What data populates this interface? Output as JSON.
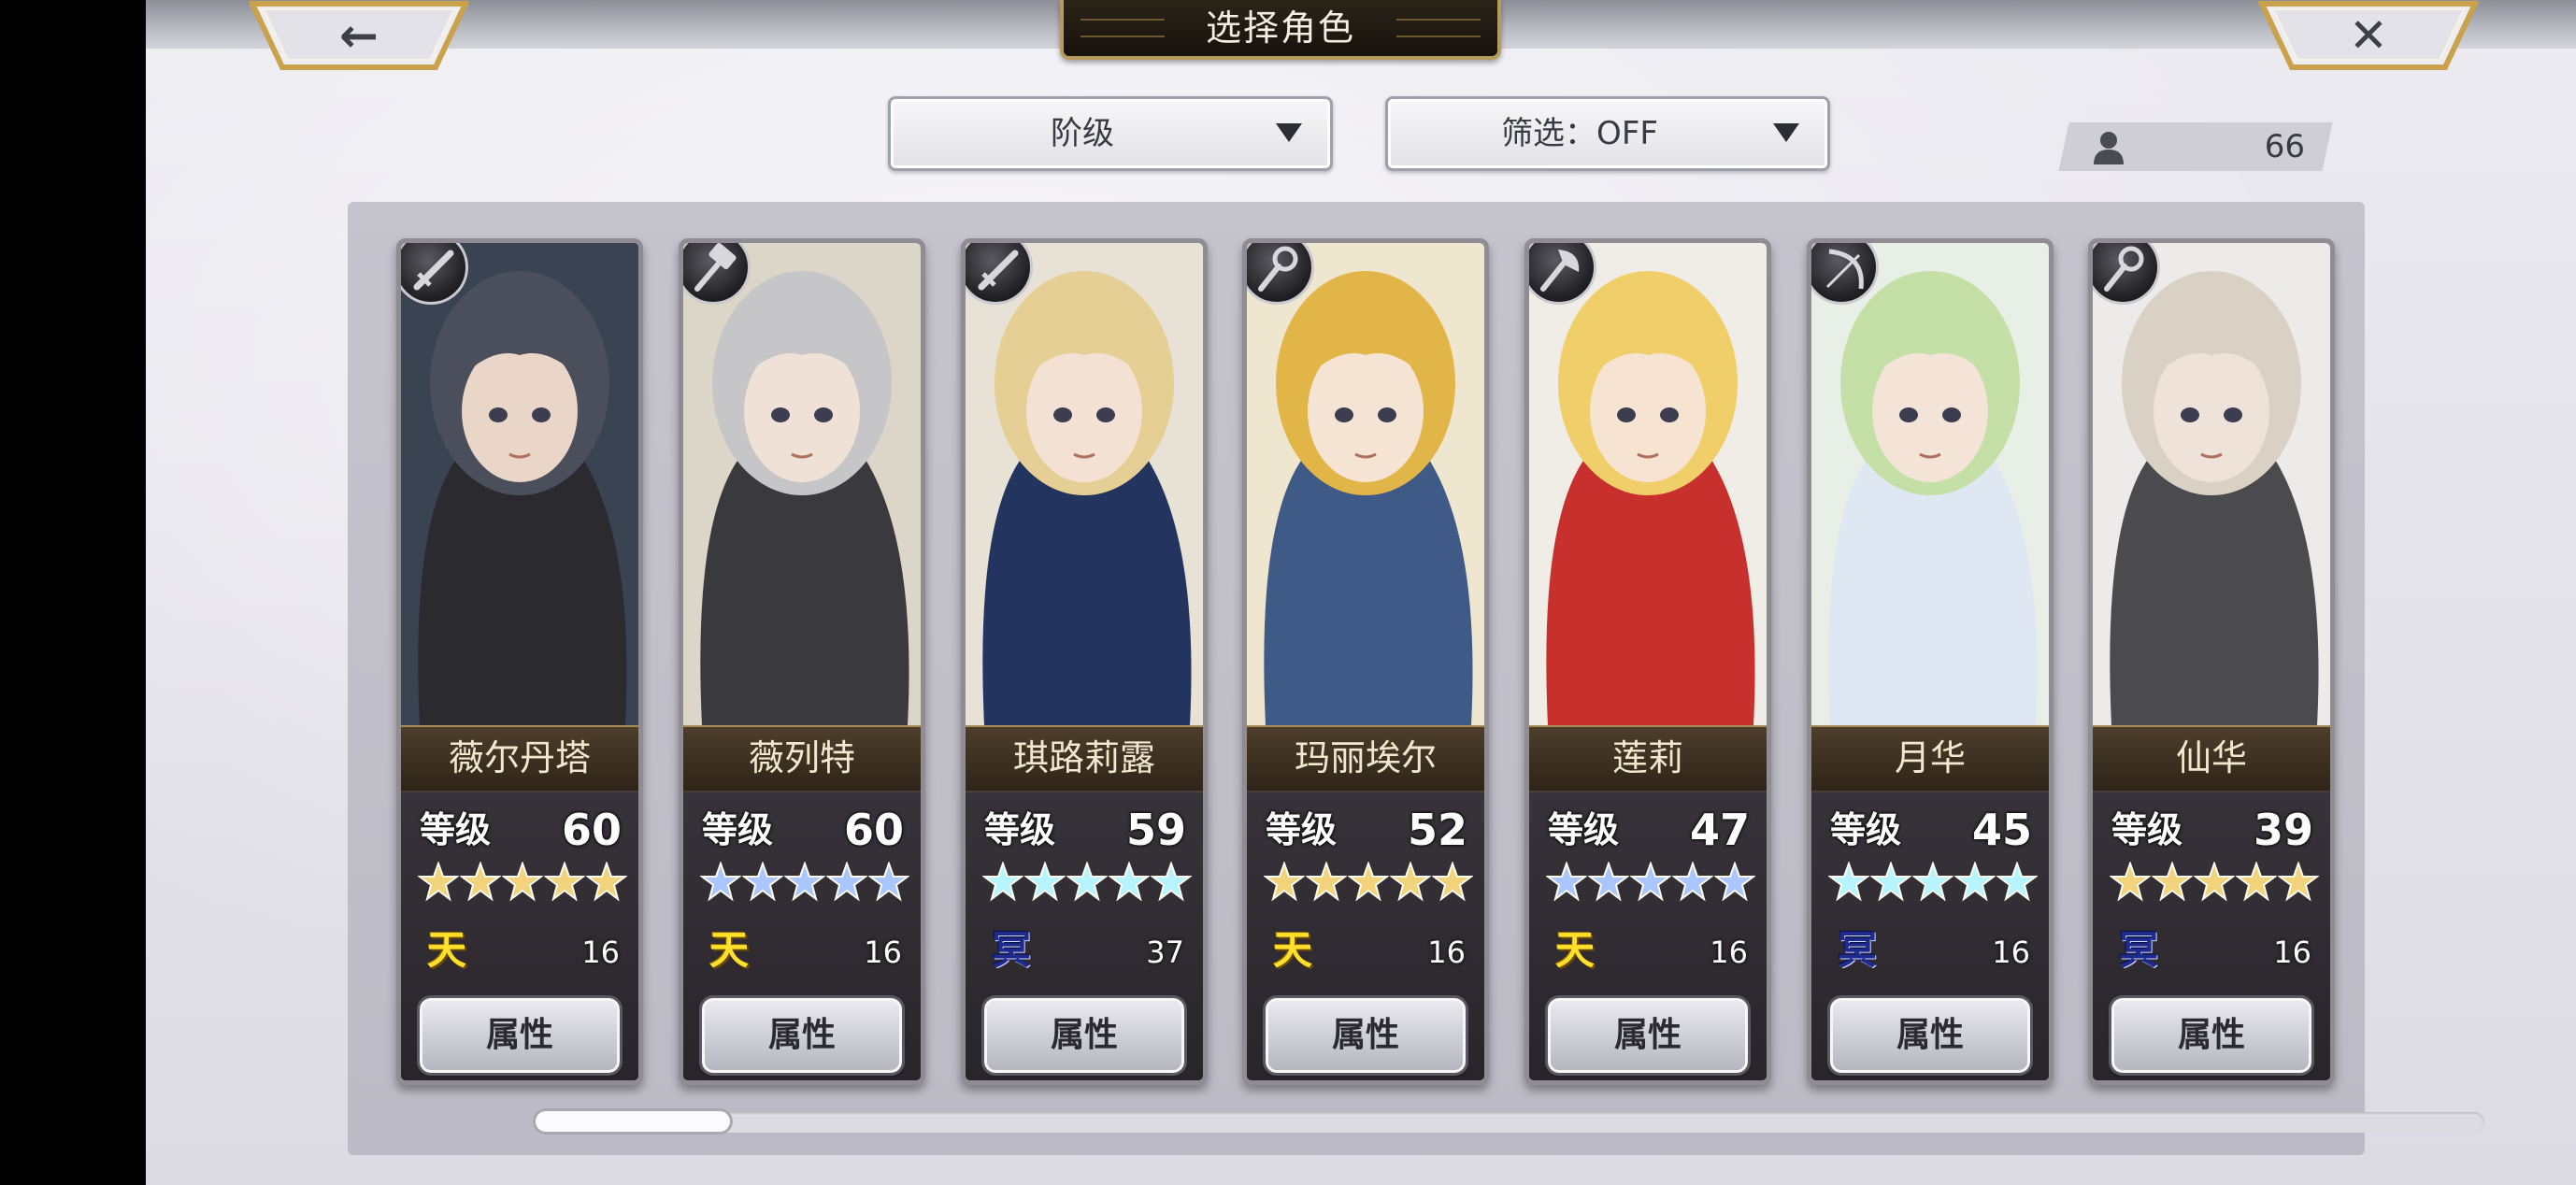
{
  "header": {
    "title": "选择角色",
    "back_icon": "arrow-left-icon",
    "close_icon": "close-icon",
    "back_glyph": "←",
    "close_glyph": "✕"
  },
  "toolbar": {
    "sort_label": "阶级",
    "filter_label": "筛选：OFF",
    "character_count": "66"
  },
  "attr_button_label": "属性",
  "level_label": "等级",
  "colors": {
    "star_gold": "#f2d27a",
    "star_blue": "#a9c6ff",
    "star_cyan": "#b6f4ff",
    "rank_gold": "#ffe12c",
    "rank_navy": "#1e2a8c"
  },
  "characters": [
    {
      "name": "薇尔丹塔",
      "level": "60",
      "stars": 5,
      "star_color": "gold",
      "rank": "天",
      "rank_style": "gold",
      "count": "16",
      "role_icon": "sword-icon",
      "art": {
        "bg": "#3a4352",
        "hair": "#4b4f5b",
        "skin": "#e9d6c9",
        "outfit": "#2b2a2f"
      }
    },
    {
      "name": "薇列特",
      "level": "60",
      "stars": 5,
      "star_color": "blue",
      "rank": "天",
      "rank_style": "gold",
      "count": "16",
      "role_icon": "hammer-icon",
      "art": {
        "bg": "#dcd6c8",
        "hair": "#c6c6c8",
        "skin": "#f0e1d6",
        "outfit": "#3a3a3e"
      }
    },
    {
      "name": "琪路莉露",
      "level": "59",
      "stars": 5,
      "star_color": "cyan",
      "rank": "冥",
      "rank_style": "navy",
      "count": "37",
      "role_icon": "sword-icon",
      "art": {
        "bg": "#e8e2d6",
        "hair": "#e6cf95",
        "skin": "#f3e2d4",
        "outfit": "#23355e"
      }
    },
    {
      "name": "玛丽埃尔",
      "level": "52",
      "stars": 5,
      "star_color": "gold",
      "rank": "天",
      "rank_style": "gold",
      "count": "16",
      "role_icon": "staff-icon",
      "art": {
        "bg": "#efe6cf",
        "hair": "#e2b548",
        "skin": "#f5e4d3",
        "outfit": "#3f5a86"
      }
    },
    {
      "name": "莲莉",
      "level": "47",
      "stars": 5,
      "star_color": "blue",
      "rank": "天",
      "rank_style": "gold",
      "count": "16",
      "role_icon": "axe-icon",
      "art": {
        "bg": "#f0ece6",
        "hair": "#f0cf6a",
        "skin": "#f6e3d2",
        "outfit": "#c8302e"
      }
    },
    {
      "name": "月华",
      "level": "45",
      "stars": 5,
      "star_color": "cyan",
      "rank": "冥",
      "rank_style": "navy",
      "count": "16",
      "role_icon": "bow-icon",
      "art": {
        "bg": "#e7efe6",
        "hair": "#c5e0a6",
        "skin": "#f3e4d7",
        "outfit": "#dfe7f2"
      }
    },
    {
      "name": "仙华",
      "level": "39",
      "stars": 5,
      "star_color": "gold",
      "rank": "冥",
      "rank_style": "navy",
      "count": "16",
      "role_icon": "staff-icon",
      "art": {
        "bg": "#ecebea",
        "hair": "#d9d1c3",
        "skin": "#efe2d8",
        "outfit": "#4a4a4f"
      }
    }
  ],
  "scroll": {
    "position": 0.0,
    "visible_fraction": 0.1
  }
}
